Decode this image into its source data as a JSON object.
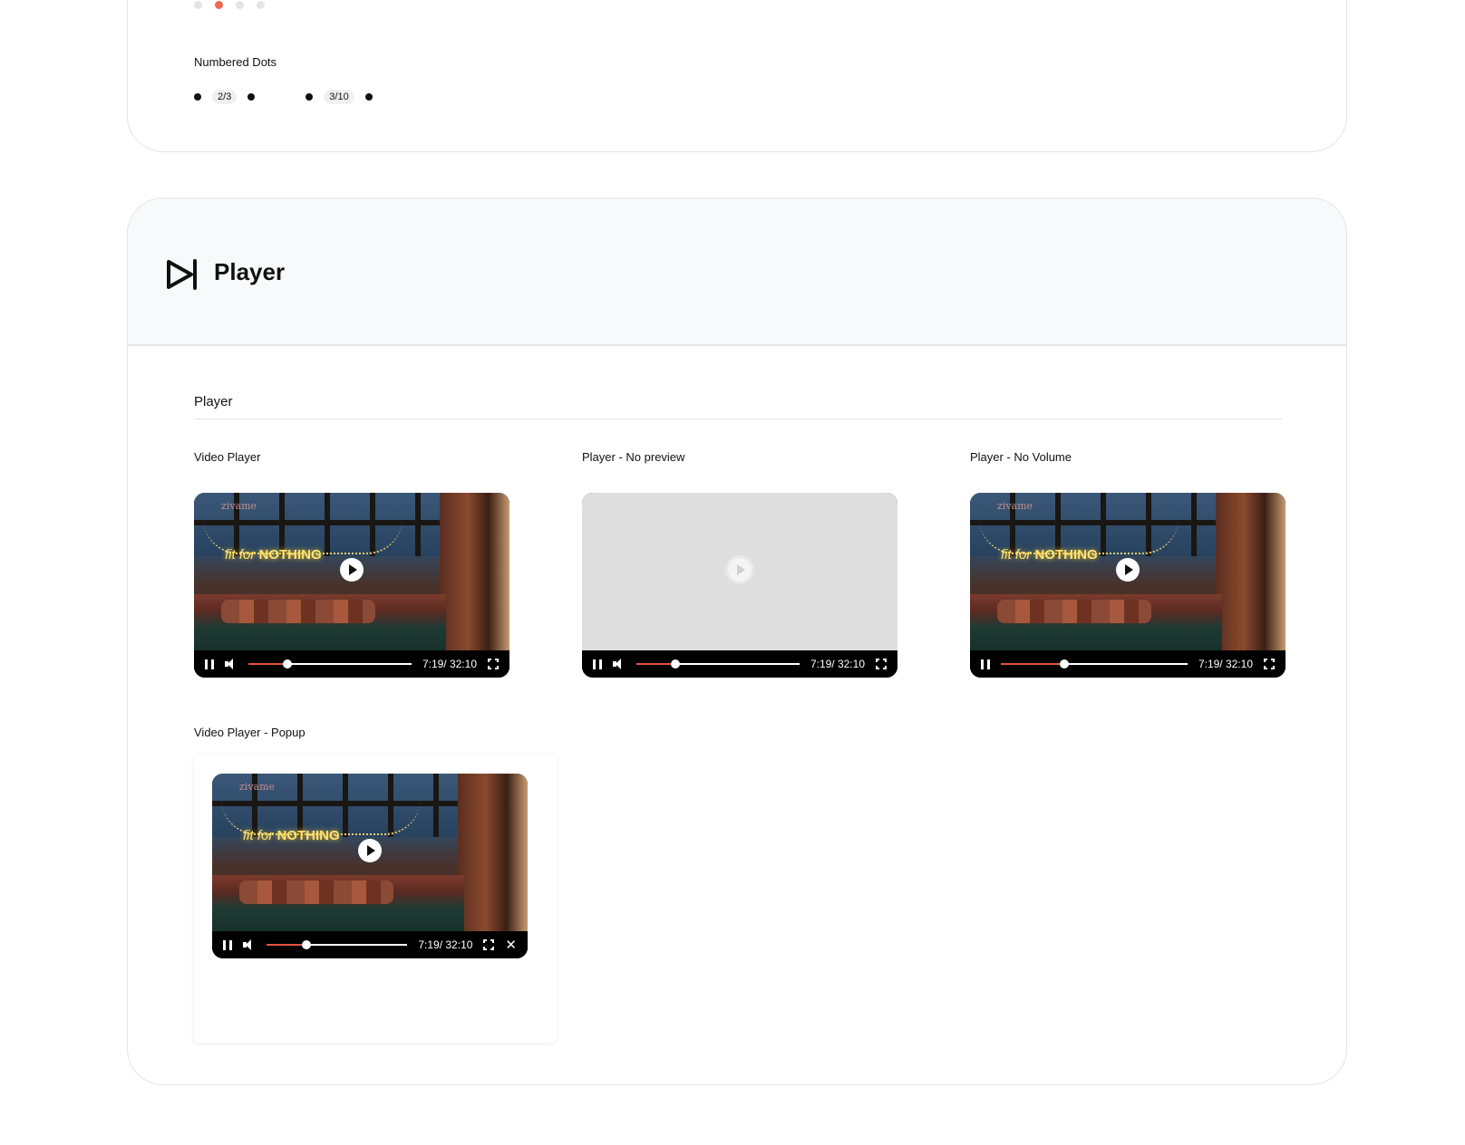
{
  "top_card": {
    "dots": [
      false,
      true,
      false,
      false
    ],
    "numbered_label": "Numbered Dots",
    "numbered_groups": [
      "2/3",
      "3/10"
    ]
  },
  "section": {
    "header_title": "Player",
    "icon": "play-skip-icon",
    "subtitle": "Player"
  },
  "players": {
    "video_player": {
      "label": "Video Player",
      "time": "7:19/ 32:10",
      "progress": 0.24
    },
    "no_preview": {
      "label": "Player - No preview",
      "time": "7:19/ 32:10",
      "progress": 0.24
    },
    "no_volume": {
      "label": "Player - No Volume",
      "time": "7:19/ 32:10",
      "progress": 0.34
    },
    "popup": {
      "label": "Video Player - Popup",
      "time": "7:19/ 32:10",
      "progress": 0.28
    }
  },
  "scene": {
    "brand": "zivame",
    "neon_prefix": "fit for ",
    "neon_bold": "NOTHING"
  },
  "colors": {
    "accent": "#e4533f",
    "active_dot": "#ee6a4f"
  }
}
